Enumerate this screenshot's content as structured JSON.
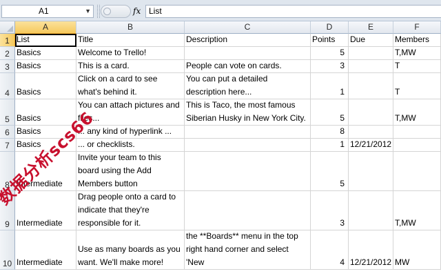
{
  "name_box": {
    "value": "A1"
  },
  "formula": {
    "fx_label": "fx",
    "value": "List"
  },
  "columns": [
    "A",
    "B",
    "C",
    "D",
    "E",
    "F"
  ],
  "selected_column": "A",
  "selected_row": "1",
  "rows": [
    {
      "num": "1",
      "cells": [
        "List",
        "Title",
        "Description",
        "Points",
        "Due",
        "Members"
      ]
    },
    {
      "num": "2",
      "cells": [
        "Basics",
        "Welcome to Trello!",
        "",
        "5",
        "",
        "T,MW"
      ]
    },
    {
      "num": "3",
      "cells": [
        "Basics",
        "This is a card.",
        "People can vote on cards.",
        "3",
        "",
        "T"
      ]
    },
    {
      "num": "4",
      "cells": [
        "Basics",
        "Click on a card to see what's behind it.",
        "You can put a detailed description here...",
        "1",
        "",
        "T"
      ]
    },
    {
      "num": "5",
      "cells": [
        "Basics",
        "You can attach pictures and files...",
        "This is Taco, the most famous Siberian Husky in New York City.",
        "5",
        "",
        "T,MW"
      ]
    },
    {
      "num": "6",
      "cells": [
        "Basics",
        "... any kind of hyperlink ...",
        "",
        "8",
        "",
        ""
      ]
    },
    {
      "num": "7",
      "cells": [
        "Basics",
        "... or checklists.",
        "",
        "1",
        "12/21/2012",
        ""
      ]
    },
    {
      "num": "8",
      "cells": [
        "Intermediate",
        "Invite your team to this board using the Add Members button",
        "",
        "5",
        "",
        ""
      ]
    },
    {
      "num": "9",
      "cells": [
        "Intermediate",
        "Drag people onto a card to indicate that they're responsible for it.",
        "",
        "3",
        "",
        "T,MW"
      ]
    },
    {
      "num": "10",
      "cells": [
        "Intermediate",
        "Use as many boards as you want. We'll make more!",
        "To make a new board, click on the **Boards** menu in the top right hand corner and select 'New",
        "4",
        "12/21/2012",
        "MW"
      ]
    }
  ],
  "watermark": "数据分析scs66"
}
